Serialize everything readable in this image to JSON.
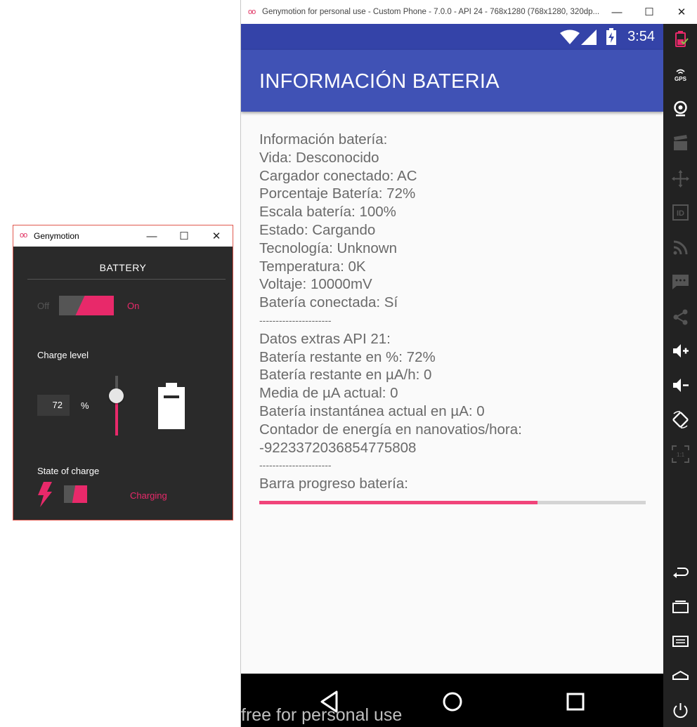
{
  "battery_window": {
    "logo": "oo",
    "title": "Genymotion",
    "controls": {
      "minimize": "—",
      "maximize": "☐",
      "close": "✕"
    },
    "heading": "BATTERY",
    "switch": {
      "off_label": "Off",
      "on_label": "On",
      "state": "on"
    },
    "charge_level_label": "Charge level",
    "charge_level_value": "72",
    "charge_level_unit": "%",
    "charge_level_fraction": 0.72,
    "state_label": "State of charge",
    "state_value": "Charging"
  },
  "phone_window": {
    "logo": "oo",
    "title": "Genymotion for personal use - Custom Phone - 7.0.0 - API 24 - 768x1280 (768x1280, 320dp...",
    "controls": {
      "minimize": "—",
      "maximize": "☐",
      "close": "✕"
    },
    "status_bar": {
      "time": "3:54"
    },
    "app_bar": {
      "title": "INFORMACIÓN BATERIA"
    },
    "info_lines": [
      "Información batería:",
      "Vida: Desconocido",
      "Cargador conectado: AC",
      "Porcentaje Batería: 72%",
      "Escala batería: 100%",
      "Estado: Cargando",
      "Tecnología: Unknown",
      "Temperatura: 0K",
      "Voltaje: 10000mV",
      "Batería conectada: Sí",
      "----------------------",
      "Datos extras API 21:",
      "Batería restante en %: 72%",
      "Batería restante en µA/h: 0",
      "Media de µA actual: 0",
      "Batería instantánea actual en µA: 0",
      "Contador de energía en nanovatios/hora:",
      "-9223372036854775808",
      "----------------------",
      "Barra progreso batería:"
    ],
    "progress_fraction": 0.72,
    "watermark": "free for personal use",
    "sidebar": {
      "gps_label": "GPS",
      "id_label": "ID",
      "ratio_label": "1:1",
      "icons": [
        "battery-icon",
        "gps-icon",
        "camera-icon",
        "clapperboard-icon",
        "move-icon",
        "id-icon",
        "rss-icon",
        "sms-icon",
        "share-icon",
        "volume-up-icon",
        "volume-down-icon",
        "rotate-icon",
        "pixel-ratio-icon",
        "back-icon",
        "recent-apps-icon",
        "menu-icon",
        "home-icon",
        "power-icon"
      ]
    }
  },
  "colors": {
    "accent": "#e8296a",
    "app_bar": "#4052b5",
    "status_bar": "#3443a8",
    "progress": "#f0447a"
  }
}
